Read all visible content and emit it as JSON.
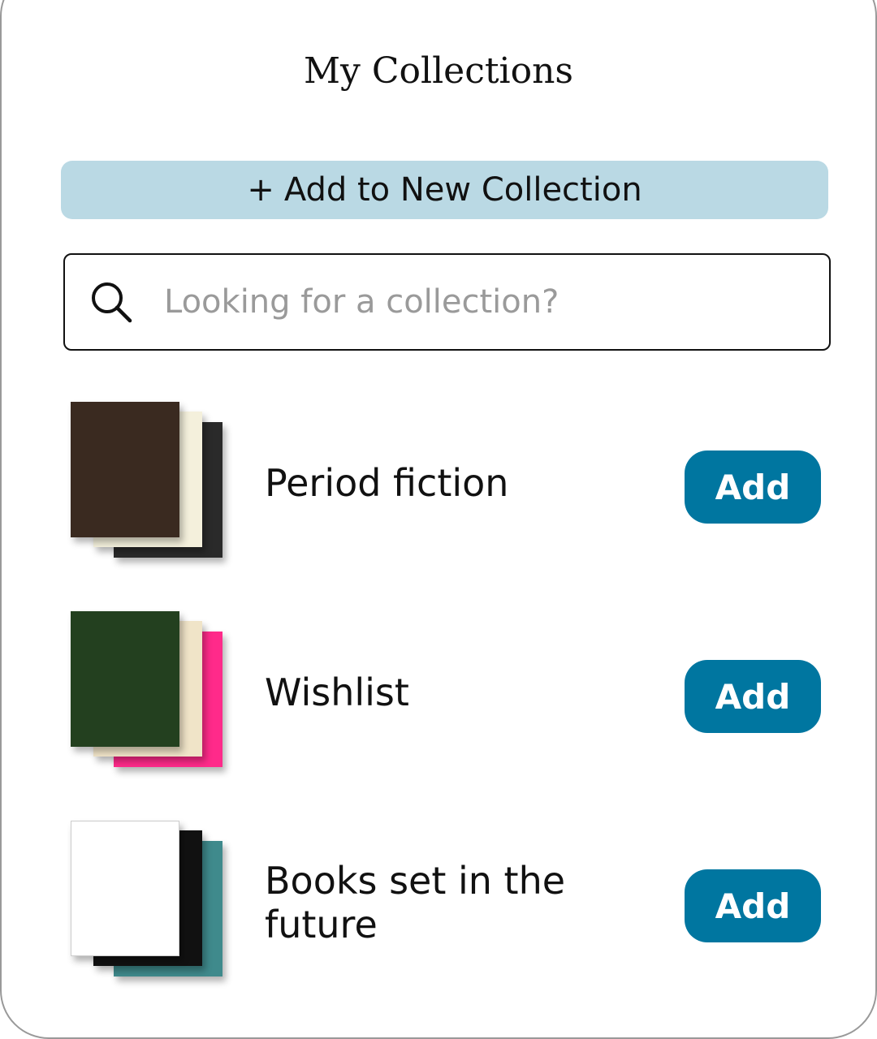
{
  "title": "My Collections",
  "new_collection": {
    "icon": "plus-icon",
    "label": "Add to New Collection",
    "plus": "+"
  },
  "search": {
    "placeholder": "Looking for a collection?",
    "value": ""
  },
  "collections": [
    {
      "name": "Period fiction",
      "button": "Add",
      "covers": [
        "#3a2a20",
        "#f4f0dc",
        "#2a2a2a"
      ]
    },
    {
      "name": "Wishlist",
      "button": "Add",
      "covers": [
        "#23401f",
        "#f0e4c8",
        "#ff2a8a"
      ]
    },
    {
      "name": "Books set in the future",
      "button": "Add",
      "covers": [
        "#ffffff",
        "#111111",
        "#3f8a8c"
      ]
    }
  ],
  "colors": {
    "accent": "#0076a0",
    "new_button": "#bad9e4"
  }
}
